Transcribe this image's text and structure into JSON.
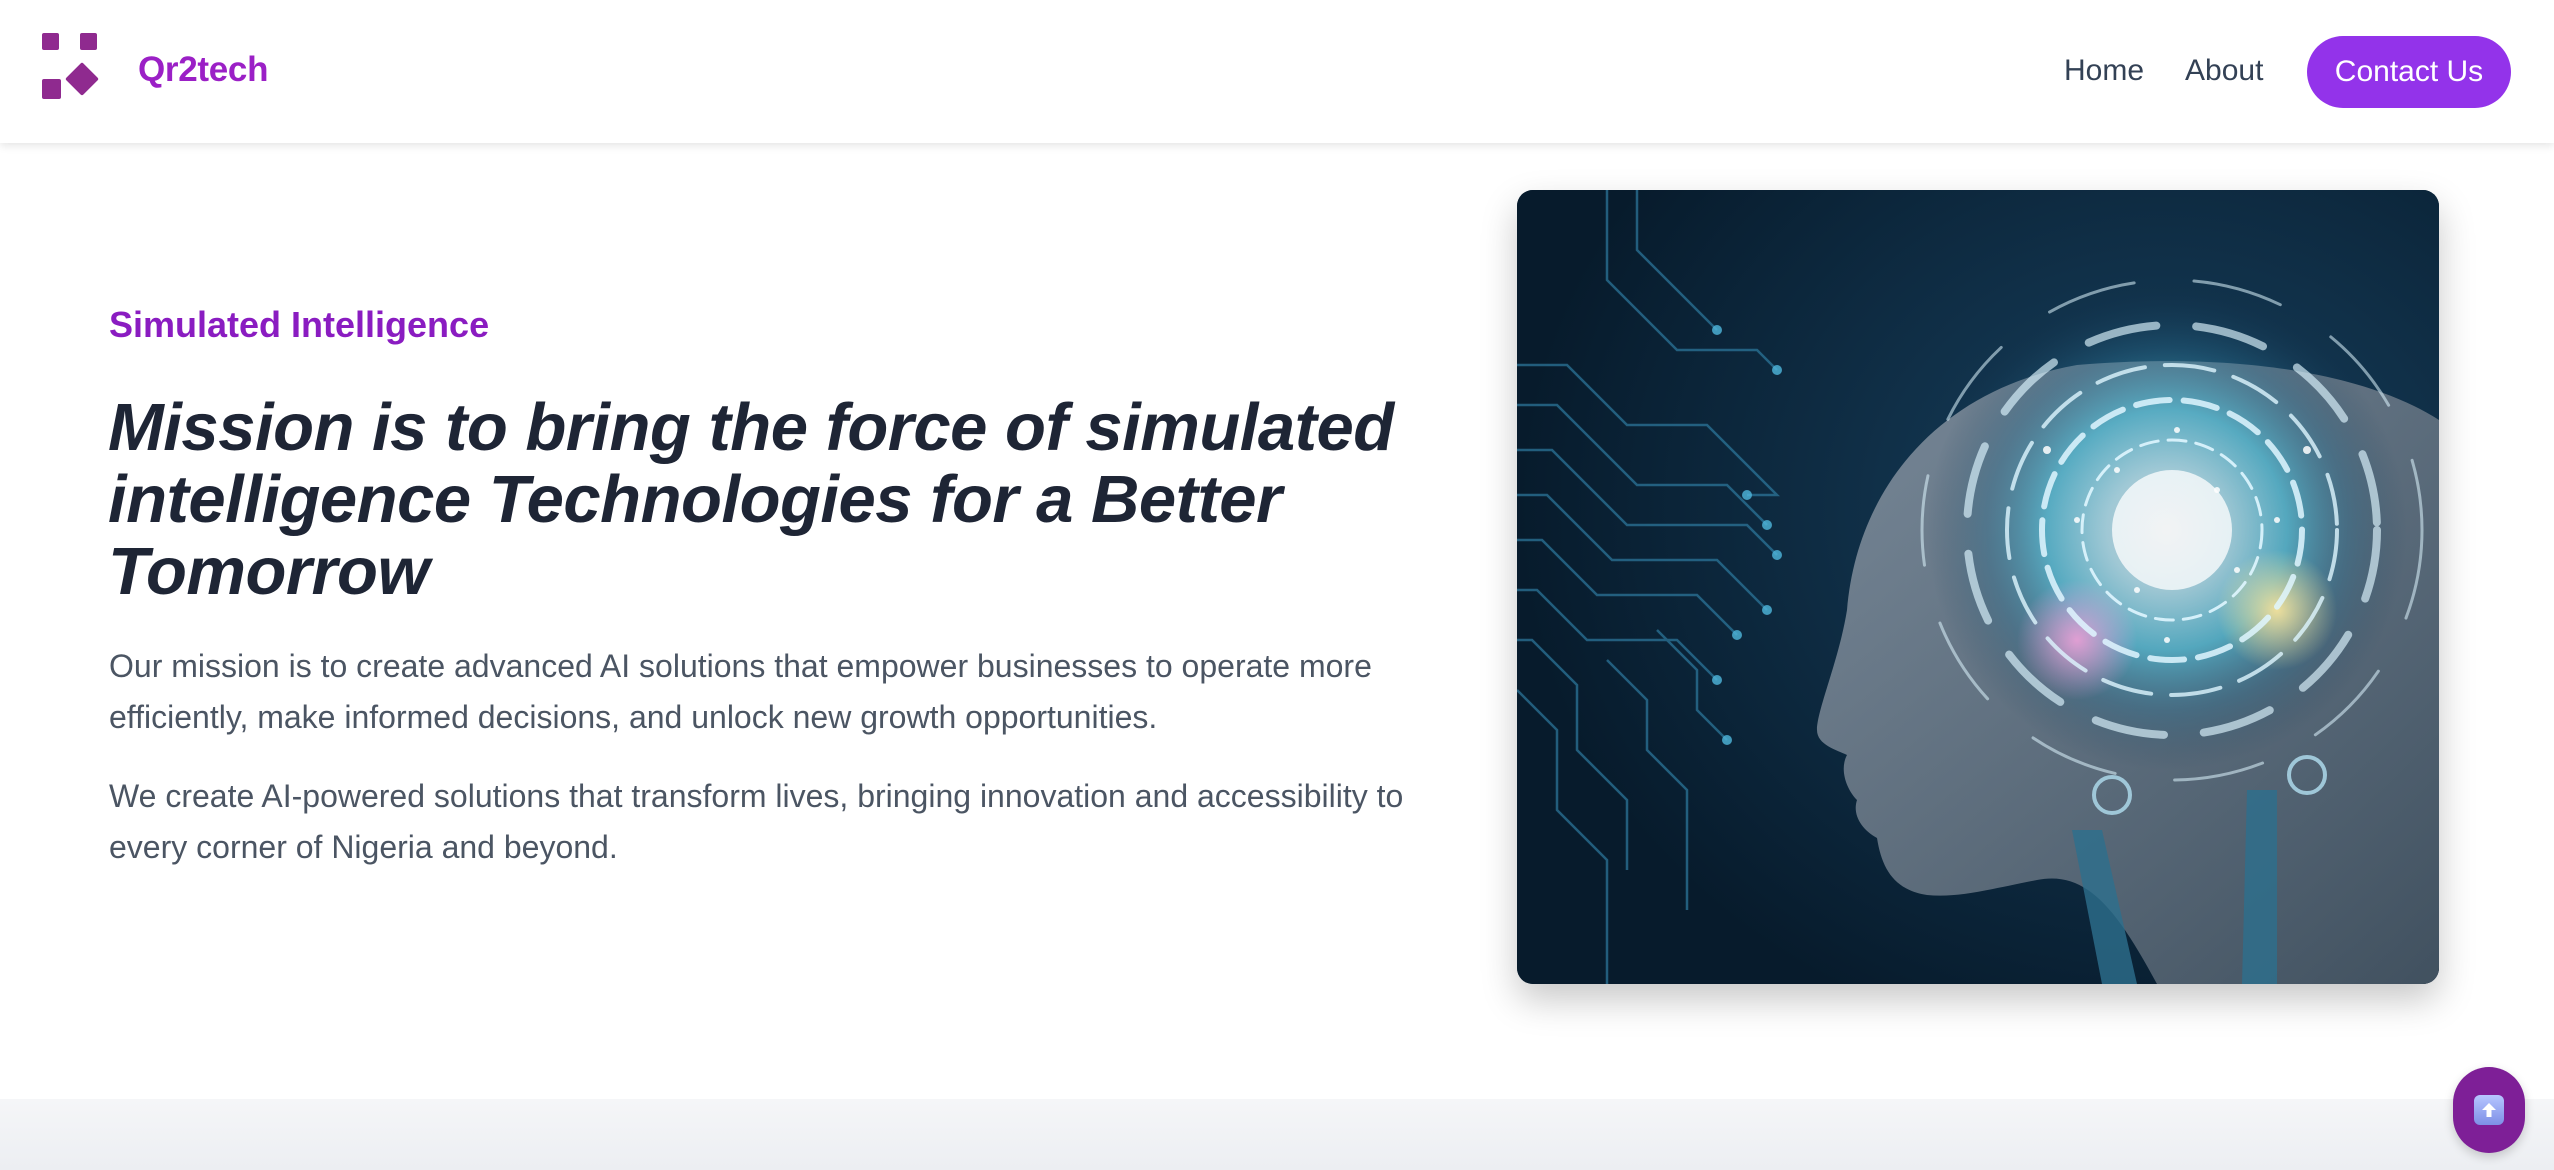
{
  "header": {
    "brand": "Qr2tech",
    "nav": {
      "home": "Home",
      "about": "About"
    },
    "contact_label": "Contact Us"
  },
  "hero": {
    "eyebrow": "Simulated Intelligence",
    "headline": "Mission is to bring the force of simulated intelligence Technologies for a Better Tomorrow",
    "paragraph_1": "Our mission is to create advanced AI solutions that empower businesses to operate more efficiently, make informed decisions, and unlock new growth opportunities.",
    "paragraph_2": "We create AI-powered solutions that transform lives, bringing innovation and accessibility to every corner of Nigeria and beyond."
  },
  "icons": {
    "logo": "qr2tech-logo-icon",
    "scroll_top": "up-arrow-icon"
  },
  "colors": {
    "brand": "#9b20c6",
    "button": "#9333ea",
    "scroll_button": "#7e1f97",
    "headline": "#1e2535",
    "body_text": "#4b5563"
  }
}
